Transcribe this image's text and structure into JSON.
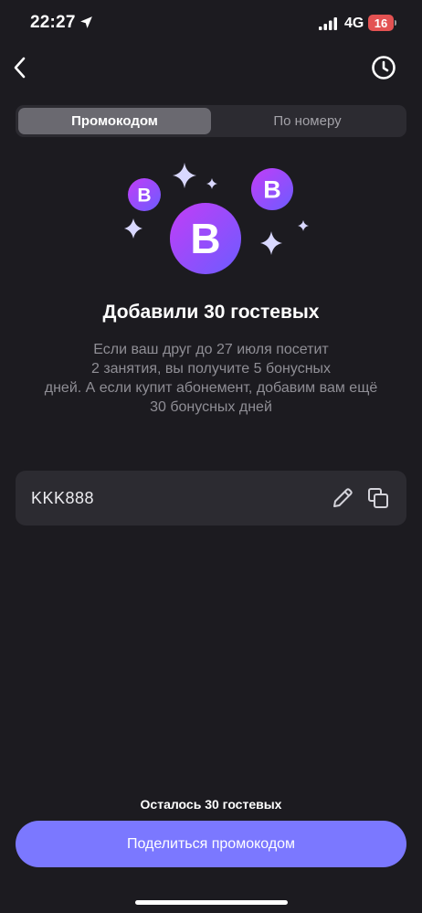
{
  "status_bar": {
    "time": "22:27",
    "network": "4G",
    "battery": "16",
    "icons": [
      "location-arrow-icon",
      "cellular-signal-icon",
      "battery-icon"
    ]
  },
  "nav": {
    "icons": [
      "chevron-left-icon",
      "clock-history-icon"
    ]
  },
  "tabs": [
    {
      "label": "Промокодом",
      "active": true
    },
    {
      "label": "По номеру",
      "active": false
    }
  ],
  "illustration": {
    "badge_letter": "B",
    "icons": [
      "sparkle-icon",
      "b-coin-icon"
    ]
  },
  "content": {
    "title": "Добавили 30 гостевых",
    "description_lines": [
      "Если ваш друг до 27 июля посетит",
      "2 занятия, вы получите 5 бонусных",
      "дней. А если купит абонемент, добавим вам ещё",
      "30 бонусных дней"
    ]
  },
  "promo": {
    "code": "KKK888",
    "icons": [
      "pencil-edit-icon",
      "copy-icon"
    ]
  },
  "footer": {
    "remaining": "Осталось 30 гостевых",
    "share_label": "Поделиться промокодом"
  },
  "colors": {
    "background": "#1c1b20",
    "surface": "#2c2b31",
    "accent": "#7b78ff",
    "coin_gradient_start": "#c23df7",
    "coin_gradient_end": "#6c5cff",
    "sparkle": "#d9d8ff",
    "battery_low": "#e35252"
  }
}
